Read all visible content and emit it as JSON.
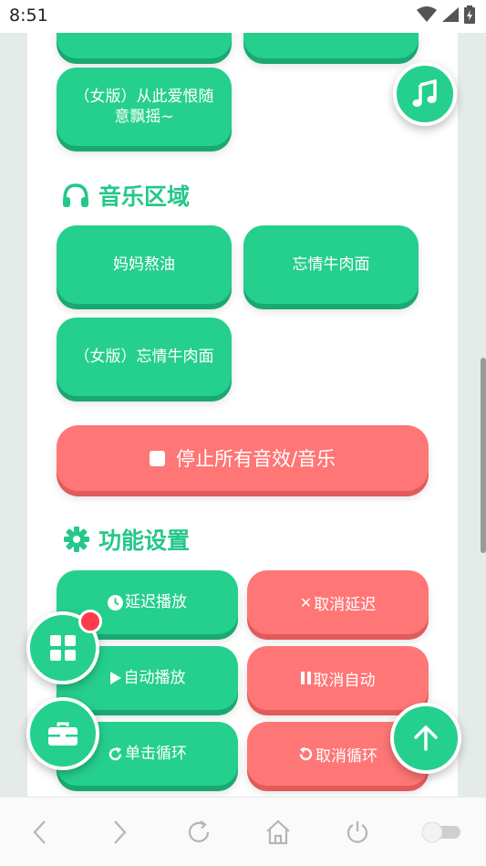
{
  "status_bar": {
    "time": "8:51"
  },
  "top_buttons": [
    {
      "label": ""
    },
    {
      "label": ""
    },
    {
      "label": "（女版）从此爱恨随意飘摇~"
    }
  ],
  "music_section": {
    "title": "音乐区域",
    "buttons": [
      "妈妈熬油",
      "忘情牛肉面",
      "（女版）忘情牛肉面"
    ]
  },
  "stop_all_label": "停止所有音效/音乐",
  "function_section": {
    "title": "功能设置",
    "delay_play": "延迟播放",
    "cancel_delay": "取消延迟",
    "auto_play": "自动播放",
    "cancel_auto": "取消自动",
    "single_loop": "单击循环",
    "cancel_loop": "取消循环"
  },
  "colors": {
    "primary_green": "#25cf8e",
    "danger_red": "#ff7676",
    "notification_dot": "#ff3b4b"
  },
  "icons": {
    "music": "music-note-icon",
    "headphones": "headphones-icon",
    "gear": "gear-icon",
    "grid": "grid-icon",
    "toolbox": "toolbox-icon",
    "arrow_up": "arrow-up-icon"
  }
}
